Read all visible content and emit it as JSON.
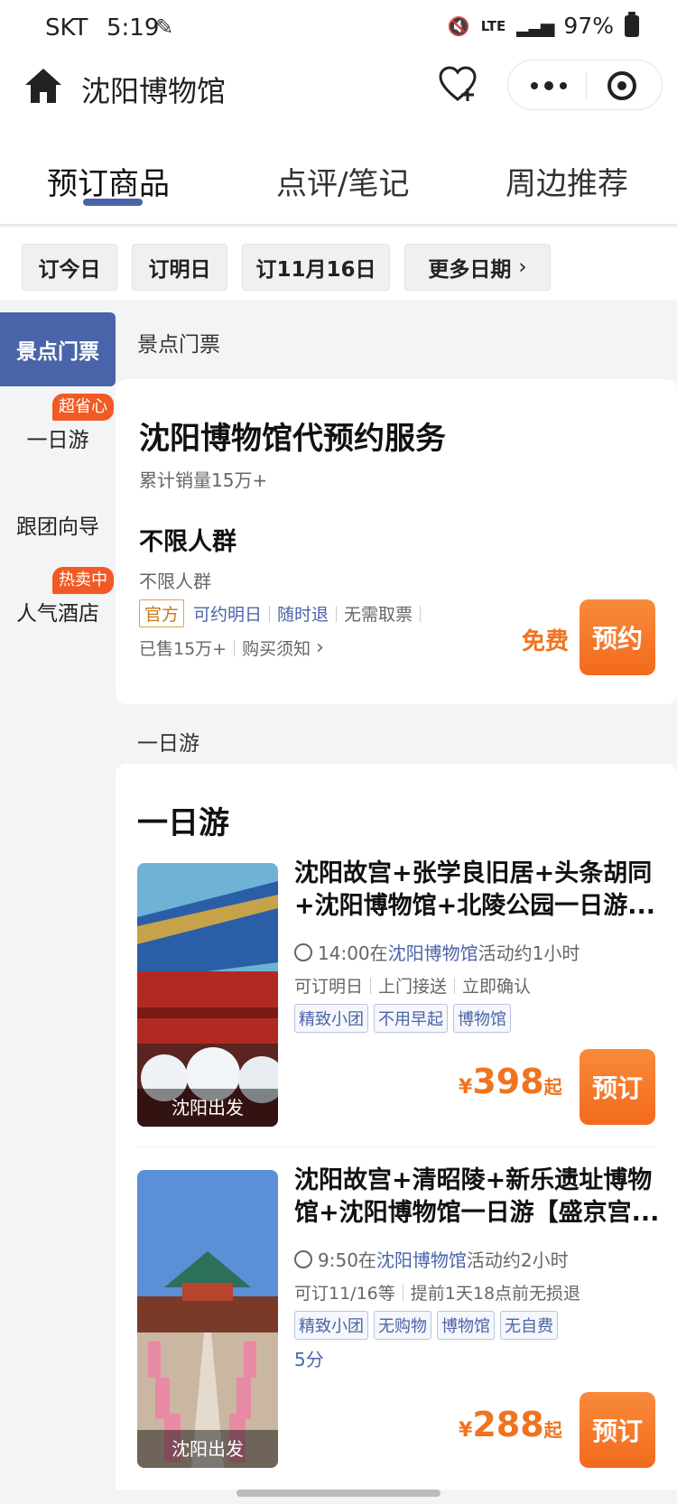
{
  "status_bar": {
    "carrier": "SKT",
    "time": "5:19",
    "network": "LTE",
    "battery": "97%"
  },
  "header": {
    "title": "沈阳博物馆"
  },
  "tabs": [
    {
      "label": "预订商品",
      "active": true
    },
    {
      "label": "点评/笔记",
      "active": false
    },
    {
      "label": "周边推荐",
      "active": false
    }
  ],
  "date_chips": [
    "订今日",
    "订明日",
    "订11月16日",
    "更多日期"
  ],
  "sidebar": {
    "items": [
      {
        "label": "景点门票",
        "active": true
      },
      {
        "label": "一日游",
        "badge": "超省心"
      },
      {
        "label": "跟团向导"
      },
      {
        "label": "人气酒店",
        "badge": "热卖中"
      }
    ]
  },
  "tickets": {
    "section_label": "景点门票",
    "card_title": "沈阳博物馆代预约服务",
    "sales_total": "累计销量15万+",
    "product_name": "不限人群",
    "product_sub": "不限人群",
    "tags": [
      "官方",
      "可约明日",
      "随时退",
      "无需取票"
    ],
    "sold": "已售15万+",
    "notice": "购买须知",
    "price": "免费",
    "button": "预约"
  },
  "day_tours": {
    "section_label": "一日游",
    "card_title": "一日游",
    "items": [
      {
        "title": "沈阳故宫+张学良旧居+头条胡同+沈阳博物馆+北陵公园一日游...",
        "time_prefix": "14:00在",
        "time_place": "沈阳博物馆",
        "time_suffix": "活动约1小时",
        "features": [
          "可订明日",
          "上门接送",
          "立即确认"
        ],
        "tags": [
          "精致小团",
          "不用早起",
          "博物馆"
        ],
        "thumb_label": "沈阳出发",
        "currency": "¥",
        "price": "398",
        "price_suffix": "起",
        "button": "预订"
      },
      {
        "title": "沈阳故宫+清昭陵+新乐遗址博物馆+沈阳博物馆一日游【盛京宫...",
        "time_prefix": "9:50在",
        "time_place": "沈阳博物馆",
        "time_suffix": "活动约2小时",
        "features": [
          "可订11/16等",
          "提前1天18点前无损退"
        ],
        "tags": [
          "精致小团",
          "无购物",
          "博物馆",
          "无自费"
        ],
        "rating": "5分",
        "thumb_label": "沈阳出发",
        "currency": "¥",
        "price": "288",
        "price_suffix": "起",
        "button": "预订"
      }
    ]
  },
  "colors": {
    "accent_blue": "#4a64a9",
    "accent_orange": "#f0731f",
    "button_orange": "#f26a1d",
    "badge_red": "#f15a24"
  }
}
